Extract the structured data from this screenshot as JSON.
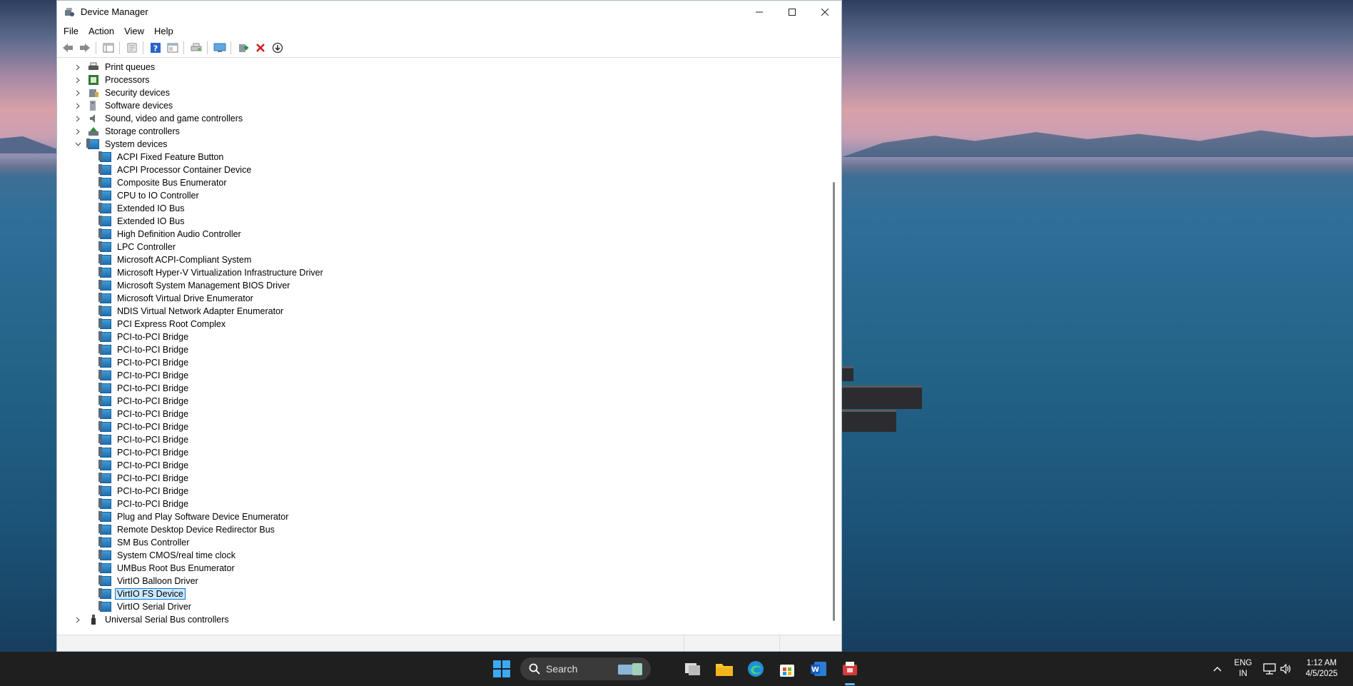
{
  "window": {
    "title": "Device Manager",
    "menus": [
      "File",
      "Action",
      "View",
      "Help"
    ]
  },
  "tree": {
    "categories_top": [
      {
        "label": "Print queues",
        "icon": "printer-icon"
      },
      {
        "label": "Processors",
        "icon": "processor-icon"
      },
      {
        "label": "Security devices",
        "icon": "security-device-icon"
      },
      {
        "label": "Software devices",
        "icon": "software-device-icon"
      },
      {
        "label": "Sound, video and game controllers",
        "icon": "speaker-icon"
      },
      {
        "label": "Storage controllers",
        "icon": "storage-controller-icon"
      }
    ],
    "expanded_category": {
      "label": "System devices",
      "icon": "system-devices-icon"
    },
    "system_devices": [
      "ACPI Fixed Feature Button",
      "ACPI Processor Container Device",
      "Composite Bus Enumerator",
      "CPU to IO Controller",
      "Extended IO Bus",
      "Extended IO Bus",
      "High Definition Audio Controller",
      "LPC Controller",
      "Microsoft ACPI-Compliant System",
      "Microsoft Hyper-V Virtualization Infrastructure Driver",
      "Microsoft System Management BIOS Driver",
      "Microsoft Virtual Drive Enumerator",
      "NDIS Virtual Network Adapter Enumerator",
      "PCI Express Root Complex",
      "PCI-to-PCI Bridge",
      "PCI-to-PCI Bridge",
      "PCI-to-PCI Bridge",
      "PCI-to-PCI Bridge",
      "PCI-to-PCI Bridge",
      "PCI-to-PCI Bridge",
      "PCI-to-PCI Bridge",
      "PCI-to-PCI Bridge",
      "PCI-to-PCI Bridge",
      "PCI-to-PCI Bridge",
      "PCI-to-PCI Bridge",
      "PCI-to-PCI Bridge",
      "PCI-to-PCI Bridge",
      "PCI-to-PCI Bridge",
      "Plug and Play Software Device Enumerator",
      "Remote Desktop Device Redirector Bus",
      "SM Bus Controller",
      "System CMOS/real time clock",
      "UMBus Root Bus Enumerator",
      "VirtIO Balloon Driver",
      "VirtIO FS Device",
      "VirtIO Serial Driver"
    ],
    "selected_device": "VirtIO FS Device",
    "categories_bottom": [
      {
        "label": "Universal Serial Bus controllers",
        "icon": "usb-icon"
      }
    ]
  },
  "taskbar": {
    "search_label": "Search",
    "lang_line1": "ENG",
    "lang_line2": "IN",
    "time": "1:12 AM",
    "date": "4/5/2025"
  },
  "colors": {
    "selection_fill": "#cce8ff",
    "selection_border": "#0078d7",
    "taskbar": "#1f1f1f"
  }
}
